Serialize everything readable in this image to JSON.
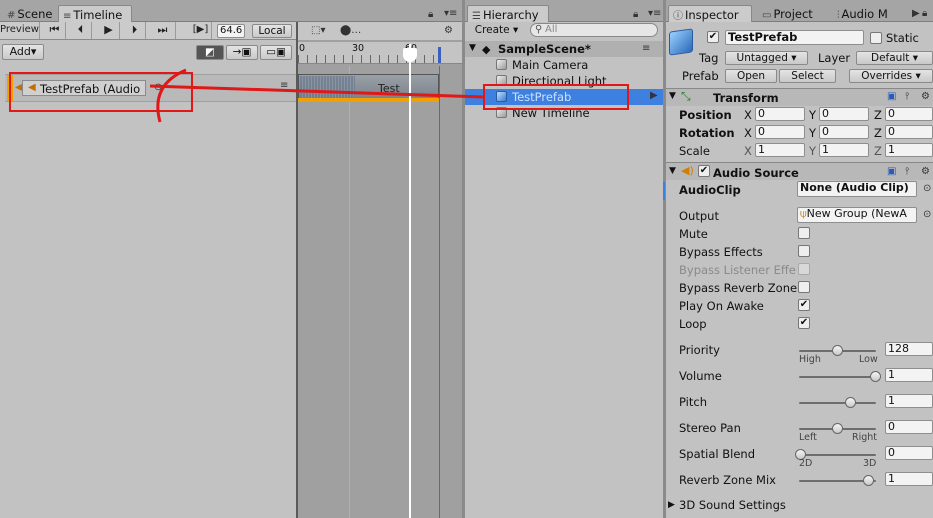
{
  "timeline_panel": {
    "tabs": [
      {
        "label": "Scene",
        "icon": "grid-icon"
      },
      {
        "label": "Timeline",
        "icon": "timeline-icon"
      }
    ],
    "toolbar": {
      "preview": "Preview",
      "frame": "64.6",
      "local": "Local",
      "add": "Add▾"
    },
    "ruler_ticks": [
      "0",
      "30",
      "60"
    ],
    "track": {
      "label": "TestPrefab (Audio",
      "clip_label": "Test"
    }
  },
  "hierarchy_panel": {
    "tab": "Hierarchy",
    "create": "Create ▾",
    "search_placeholder": "All",
    "scene": "SampleScene*",
    "items": [
      "Main Camera",
      "Directional Light",
      "TestPrefab",
      "New Timeline"
    ]
  },
  "inspector_panel": {
    "tabs": [
      {
        "label": "Inspector"
      },
      {
        "label": "Project"
      },
      {
        "label": "Audio M"
      }
    ],
    "object_name": "TestPrefab",
    "static_label": "Static",
    "tag_label": "Tag",
    "tag_value": "Untagged",
    "layer_label": "Layer",
    "layer_value": "Default",
    "prefab_label": "Prefab",
    "prefab_open": "Open",
    "prefab_select": "Select",
    "prefab_overrides": "Overrides",
    "transform": {
      "title": "Transform",
      "rows": [
        {
          "label": "Position",
          "x": "0",
          "y": "0",
          "z": "0"
        },
        {
          "label": "Rotation",
          "x": "0",
          "y": "0",
          "z": "0"
        },
        {
          "label": "Scale",
          "x": "1",
          "y": "1",
          "z": "1"
        }
      ],
      "axis_labels": [
        "X",
        "Y",
        "Z"
      ]
    },
    "audio_source": {
      "title": "Audio Source",
      "audioclip_label": "AudioClip",
      "audioclip_value": "None (Audio Clip)",
      "output_label": "Output",
      "output_value": "New Group (NewA",
      "checks": [
        {
          "label": "Mute",
          "checked": false,
          "disabled": false
        },
        {
          "label": "Bypass Effects",
          "checked": false,
          "disabled": false
        },
        {
          "label": "Bypass Listener Effe",
          "checked": false,
          "disabled": true
        },
        {
          "label": "Bypass Reverb Zone",
          "checked": false,
          "disabled": false
        },
        {
          "label": "Play On Awake",
          "checked": true,
          "disabled": false
        },
        {
          "label": "Loop",
          "checked": true,
          "disabled": false
        }
      ],
      "check_mark": "✔",
      "priority": {
        "label": "Priority",
        "value": "128",
        "level": 0.5,
        "left": "High",
        "right": "Low"
      },
      "volume": {
        "label": "Volume",
        "value": "1",
        "level": 1.0
      },
      "pitch": {
        "label": "Pitch",
        "value": "1",
        "level": 0.67
      },
      "stereo_pan": {
        "label": "Stereo Pan",
        "value": "0",
        "level": 0.5,
        "left": "Left",
        "right": "Right"
      },
      "spatial_blend": {
        "label": "Spatial Blend",
        "value": "0",
        "level": 0.0,
        "left": "2D",
        "right": "3D"
      },
      "reverb_zone_mix": {
        "label": "Reverb Zone Mix",
        "value": "1",
        "level": 0.91
      },
      "settings_3d": "3D Sound Settings"
    }
  },
  "colors": {
    "annotation_red": "#e01818",
    "track_orange": "#f0a000",
    "selection_blue": "#3d80df"
  }
}
